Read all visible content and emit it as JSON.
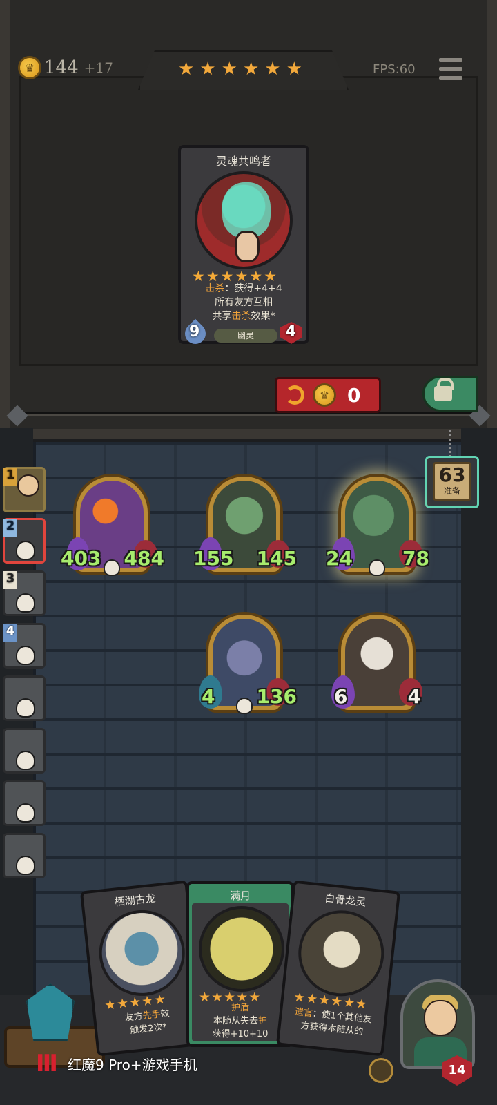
{
  "shop": {
    "gold": "144",
    "gold_income": "+17",
    "tier_stars": 6,
    "fps_label": "FPS:60",
    "card": {
      "name": "灵魂共鸣者",
      "stars": 6,
      "text_line1_kw": "击杀",
      "text_line1_rest": "：获得+4+4",
      "text_line2": "所有友方互相",
      "text_line3_a": "共享",
      "text_line3_kw": "击杀",
      "text_line3_b": "效果*",
      "attack": "9",
      "health": "4",
      "tribe": "幽灵"
    },
    "refresh_cost": "0"
  },
  "ready": {
    "count": "63",
    "label": "准备"
  },
  "opponents": [
    {
      "rank": "1",
      "state": "alive"
    },
    {
      "rank": "2",
      "state": "dead-active"
    },
    {
      "rank": "3",
      "state": "dead"
    },
    {
      "rank": "4",
      "state": "dead"
    },
    {
      "rank": "",
      "state": "dead"
    },
    {
      "rank": "",
      "state": "dead"
    },
    {
      "rank": "",
      "state": "dead"
    },
    {
      "rank": "",
      "state": "dead"
    }
  ],
  "board": {
    "row1": [
      {
        "name": "fire-boar",
        "attack": "403",
        "health": "484",
        "color": "#6a3e86"
      },
      {
        "name": "goblin-grin",
        "attack": "155",
        "health": "145",
        "color": "#3c4a3a"
      },
      {
        "name": "vulture",
        "attack": "24",
        "health": "78",
        "color": "#3e5a45",
        "golden": true
      }
    ],
    "row2": [
      {
        "name": "rat-bandit",
        "attack": "4",
        "health": "136",
        "color": "#3e4a66"
      },
      {
        "name": "masked-rabbit",
        "attack": "6",
        "health": "4",
        "color": "#4a4038"
      }
    ]
  },
  "hand": [
    {
      "name": "栖湖古龙",
      "line1_a": "友方",
      "line1_kw": "先手",
      "line1_b": "效",
      "line2": "触发2次*"
    },
    {
      "name": "满月",
      "kw_title": "护盾",
      "line1_a": "本随从失去",
      "line1_kw": "护",
      "line2": "获得+10+10"
    },
    {
      "name": "白骨龙灵",
      "line1_kw": "遗言",
      "line1_b": "：使1个其他友",
      "line2": "方获得本随从的"
    }
  ],
  "hero": {
    "health": "14"
  },
  "watermark": {
    "text": "红魔9 Pro+游戏手机"
  }
}
